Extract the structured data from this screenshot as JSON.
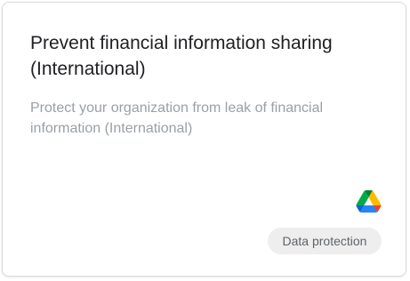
{
  "card": {
    "title": "Prevent financial information sharing (International)",
    "description": "Protect your organization from leak of financial information (International)",
    "app_icon": "google-drive-icon",
    "tag_label": "Data protection"
  },
  "colors": {
    "title": "#202124",
    "description": "#9aa0a6",
    "chip_background": "#eeeeee",
    "chip_text": "#5f6368",
    "border": "#dadce0"
  }
}
